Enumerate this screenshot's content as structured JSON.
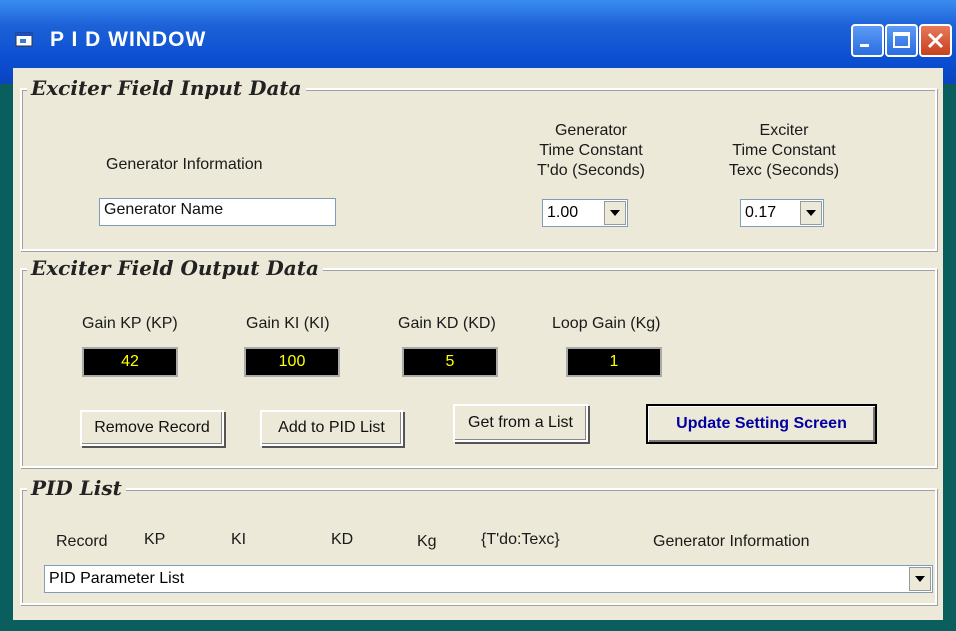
{
  "window": {
    "title": "P I D WINDOW"
  },
  "input_group": {
    "title": "Exciter Field Input Data",
    "generator_info_label": "Generator Information",
    "generator_name_value": "Generator Name",
    "tdo_label": [
      "Generator",
      "Time Constant",
      "T'do (Seconds)"
    ],
    "tdo_value": "1.00",
    "texc_label": [
      "Exciter",
      "Time Constant",
      "Texc (Seconds)"
    ],
    "texc_value": "0.17"
  },
  "output_group": {
    "title": "Exciter Field Output Data",
    "kp_label": "Gain KP (KP)",
    "ki_label": "Gain KI (KI)",
    "kd_label": "Gain KD (KD)",
    "kg_label": "Loop Gain (Kg)",
    "kp_value": "42",
    "ki_value": "100",
    "kd_value": "5",
    "kg_value": "1",
    "remove_button": "Remove Record",
    "add_button": "Add to PID List",
    "get_button": "Get from a List",
    "update_button": "Update Setting Screen"
  },
  "pid_list": {
    "title": "PID List",
    "columns": [
      "Record",
      "KP",
      "KI",
      "KD",
      "Kg",
      "{T'do:Texc}",
      "Generator Information"
    ],
    "combo_value": "PID Parameter List"
  }
}
